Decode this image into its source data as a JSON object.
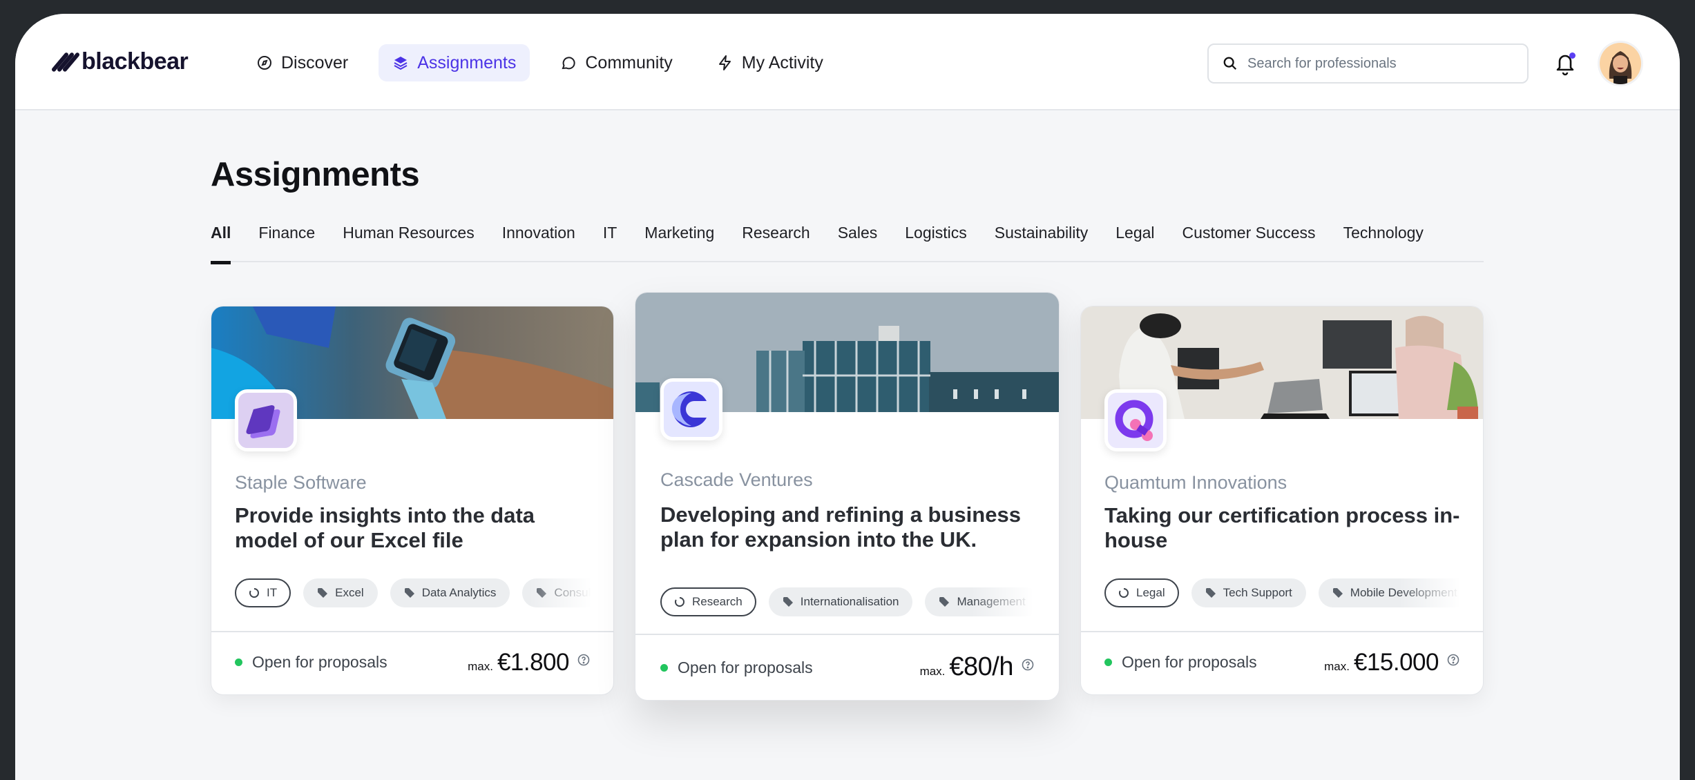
{
  "brand": {
    "name": "blackbear"
  },
  "nav": [
    {
      "label": "Discover",
      "icon": "compass-icon",
      "active": false
    },
    {
      "label": "Assignments",
      "icon": "layers-icon",
      "active": true
    },
    {
      "label": "Community",
      "icon": "chat-bubble-icon",
      "active": false
    },
    {
      "label": "My Activity",
      "icon": "lightning-icon",
      "active": false
    }
  ],
  "search": {
    "placeholder": "Search for professionals",
    "value": ""
  },
  "notifications": {
    "has_unread": true
  },
  "colors": {
    "accent": "#4b33e6",
    "status_open": "#22c55e",
    "text_muted": "#8892a0"
  },
  "page": {
    "title": "Assignments"
  },
  "tabs": [
    {
      "label": "All",
      "active": true
    },
    {
      "label": "Finance"
    },
    {
      "label": "Human Resources"
    },
    {
      "label": "Innovation"
    },
    {
      "label": "IT"
    },
    {
      "label": "Marketing"
    },
    {
      "label": "Research"
    },
    {
      "label": "Sales"
    },
    {
      "label": "Logistics"
    },
    {
      "label": "Sustainability"
    },
    {
      "label": "Legal"
    },
    {
      "label": "Customer Success"
    },
    {
      "label": "Technology"
    }
  ],
  "cards": [
    {
      "company": "Staple Software",
      "title": "Provide insights into the data model of our Excel file",
      "category": "IT",
      "tags": [
        "Excel",
        "Data Analytics",
        "Consulting"
      ],
      "status": "Open for proposals",
      "price_prefix": "max.",
      "price": "€1.800",
      "banner": "smartwatch-photo",
      "logo": "staple-logo"
    },
    {
      "company": "Cascade Ventures",
      "title": "Developing and refining a business plan for expansion into the UK.",
      "category": "Research",
      "tags": [
        "Internationalisation",
        "Management"
      ],
      "status": "Open for proposals",
      "price_prefix": "max.",
      "price": "€80/h",
      "banner": "office-building-photo",
      "logo": "cascade-logo"
    },
    {
      "company": "Quamtum Innovations",
      "title": "Taking our certification process in-house",
      "category": "Legal",
      "tags": [
        "Tech Support",
        "Mobile Development"
      ],
      "status": "Open for proposals",
      "price_prefix": "max.",
      "price": "€15.000",
      "banner": "vr-office-photo",
      "logo": "quamtum-logo"
    }
  ]
}
